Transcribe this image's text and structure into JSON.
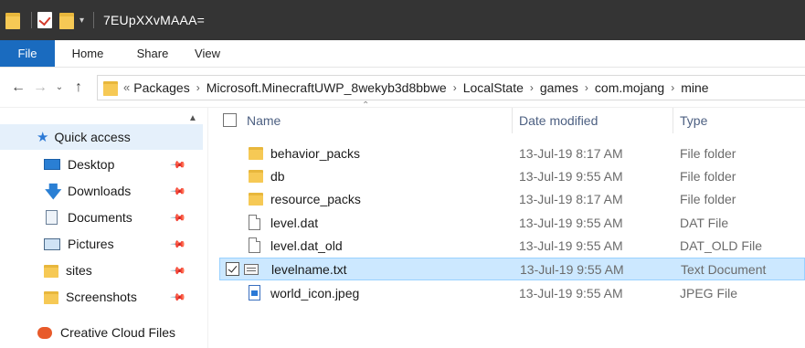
{
  "titlebar": {
    "title": "7EUpXXvMAAA="
  },
  "ribbon": {
    "tabs": [
      "File",
      "Home",
      "Share",
      "View"
    ]
  },
  "address": {
    "overflow": "«",
    "crumbs": [
      "Packages",
      "Microsoft.MinecraftUWP_8wekyb3d8bbwe",
      "LocalState",
      "games",
      "com.mojang",
      "mine"
    ]
  },
  "nav": {
    "quick_access": "Quick access",
    "items": [
      {
        "label": "Desktop",
        "icon": "desktop-icon",
        "pinned": true
      },
      {
        "label": "Downloads",
        "icon": "download-arrow-icon",
        "pinned": true
      },
      {
        "label": "Documents",
        "icon": "documents-icon",
        "pinned": true
      },
      {
        "label": "Pictures",
        "icon": "pictures-icon",
        "pinned": true
      },
      {
        "label": "sites",
        "icon": "folder-icon",
        "pinned": true
      },
      {
        "label": "Screenshots",
        "icon": "folder-icon",
        "pinned": true
      }
    ],
    "creative_cloud": "Creative Cloud Files"
  },
  "columns": {
    "name": "Name",
    "date": "Date modified",
    "type": "Type"
  },
  "files": [
    {
      "name": "behavior_packs",
      "date": "13-Jul-19 8:17 AM",
      "type": "File folder",
      "icon": "folder-icon"
    },
    {
      "name": "db",
      "date": "13-Jul-19 9:55 AM",
      "type": "File folder",
      "icon": "folder-icon"
    },
    {
      "name": "resource_packs",
      "date": "13-Jul-19 8:17 AM",
      "type": "File folder",
      "icon": "folder-icon"
    },
    {
      "name": "level.dat",
      "date": "13-Jul-19 9:55 AM",
      "type": "DAT File",
      "icon": "file-icon"
    },
    {
      "name": "level.dat_old",
      "date": "13-Jul-19 9:55 AM",
      "type": "DAT_OLD File",
      "icon": "file-icon"
    },
    {
      "name": "levelname.txt",
      "date": "13-Jul-19 9:55 AM",
      "type": "Text Document",
      "icon": "text-file-icon",
      "selected": true
    },
    {
      "name": "world_icon.jpeg",
      "date": "13-Jul-19 9:55 AM",
      "type": "JPEG File",
      "icon": "image-file-icon"
    }
  ],
  "colors": {
    "titlebar_bg": "#343434",
    "file_tab_bg": "#1a6bbf",
    "selection_bg": "#cce8ff",
    "quick_access_bg": "#e5f0fb",
    "folder": "#f6c955"
  }
}
